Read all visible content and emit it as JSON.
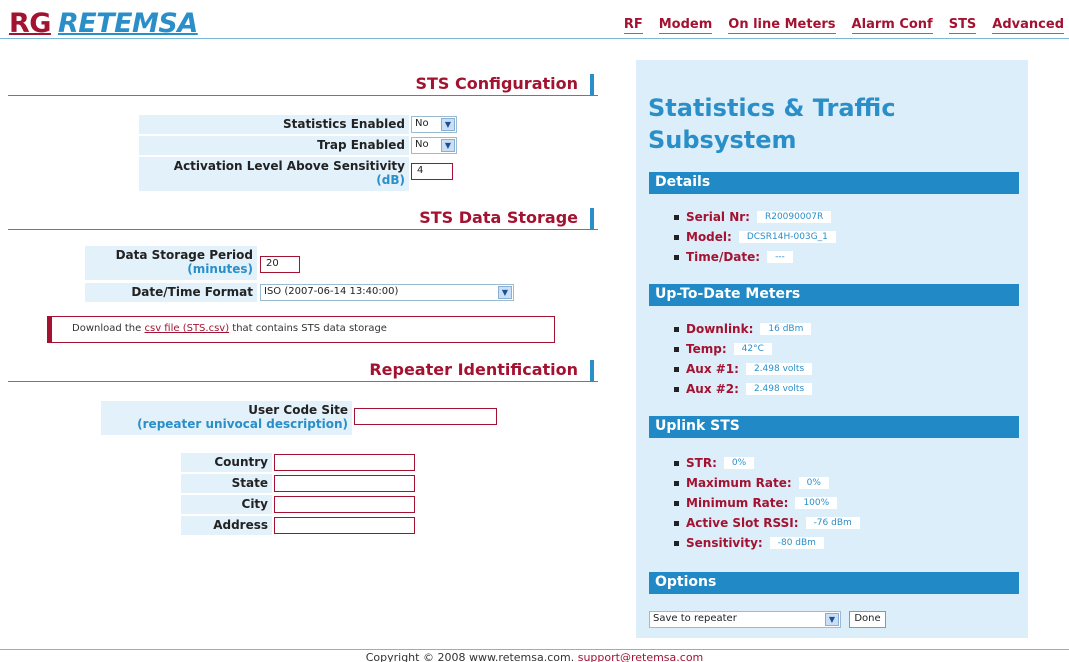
{
  "header": {
    "logo_rg": "RG",
    "logo_name": "RETEMSA",
    "nav": [
      "RF",
      "Modem",
      "On line Meters",
      "Alarm Conf",
      "STS",
      "Advanced"
    ]
  },
  "sts_config": {
    "title": "STS Configuration",
    "statistics_label": "Statistics Enabled",
    "statistics_value": "No",
    "trap_label": "Trap Enabled",
    "trap_value": "No",
    "activation_label": "Activation Level Above Sensitivity",
    "activation_unit": "(dB)",
    "activation_value": "4"
  },
  "storage": {
    "title": "STS Data Storage",
    "period_label": "Data Storage Period",
    "period_unit": "(minutes)",
    "period_value": "20",
    "format_label": "Date/Time Format",
    "format_value": "ISO (2007-06-14 13:40:00)",
    "download_prefix": "Download the ",
    "download_link": "csv file (STS.csv)",
    "download_suffix": " that contains STS data storage"
  },
  "identification": {
    "title": "Repeater Identification",
    "user_code_label": "User Code Site",
    "user_code_sub": "(repeater univocal description)",
    "user_code_value": "",
    "country_label": "Country",
    "state_label": "State",
    "city_label": "City",
    "address_label": "Address"
  },
  "panel": {
    "title_line1": "Statistics & Traffic",
    "title_line2": "Subsystem",
    "details": {
      "title": "Details",
      "items": [
        {
          "label": "Serial Nr:",
          "value": "R20090007R"
        },
        {
          "label": "Model:",
          "value": "DCSR14H-003G_1"
        },
        {
          "label": "Time/Date:",
          "value": "---"
        }
      ]
    },
    "meters": {
      "title": "Up-To-Date Meters",
      "items": [
        {
          "label": "Downlink:",
          "value": "16 dBm"
        },
        {
          "label": "Temp:",
          "value": "42°C"
        },
        {
          "label": "Aux #1:",
          "value": "2.498 volts"
        },
        {
          "label": "Aux #2:",
          "value": "2.498 volts"
        }
      ]
    },
    "uplink": {
      "title": "Uplink STS",
      "items": [
        {
          "label": "STR:",
          "value": "0%"
        },
        {
          "label": "Maximum Rate:",
          "value": "0%"
        },
        {
          "label": "Minimum Rate:",
          "value": "100%"
        },
        {
          "label": "Active Slot RSSI:",
          "value": "-76 dBm"
        },
        {
          "label": "Sensitivity:",
          "value": "-80 dBm"
        }
      ]
    },
    "options": {
      "title": "Options",
      "select_value": "Save to repeater",
      "done_label": "Done"
    }
  },
  "footer": {
    "copyright": "Copyright © 2008 www.retemsa.com. ",
    "support": "support@retemsa.com"
  },
  "colors": {
    "accent": "#a31331",
    "blue": "#2a8fc9",
    "panel_bg": "#dceef9",
    "bar": "#2189c5"
  }
}
